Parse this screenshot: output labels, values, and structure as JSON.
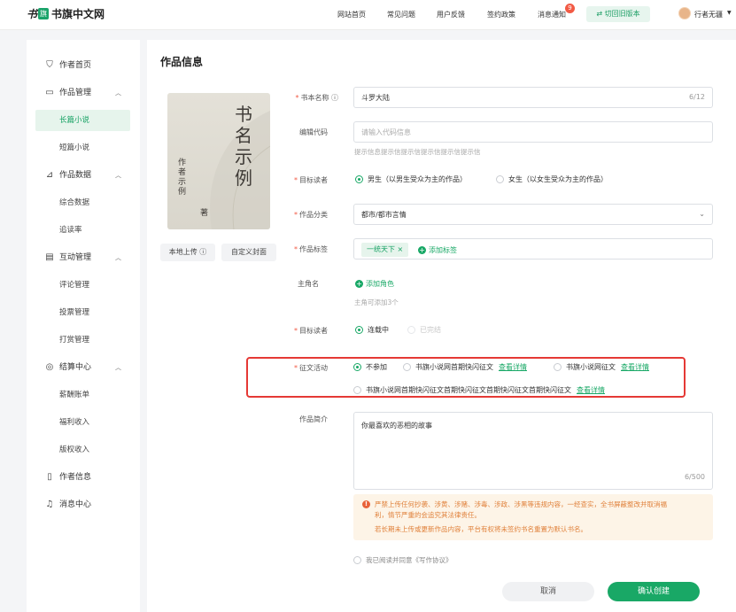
{
  "header": {
    "logo_mark": "书",
    "logo_box": "旗",
    "logo_text": "书旗中文网",
    "nav": [
      "网站首页",
      "常见问题",
      "用户反馈",
      "签约政策",
      "消息通知"
    ],
    "notification_count": "9",
    "switch_label": "⇄ 切回旧版本",
    "username": "行者无疆",
    "caret": "▼"
  },
  "sidebar": {
    "home": "作者首页",
    "works_manage": "作品管理",
    "long_novel": "长篇小说",
    "short_novel": "短篇小说",
    "works_data": "作品数据",
    "overall_data": "综合数据",
    "follow_rate": "追读率",
    "interaction": "互动管理",
    "comment_manage": "评论管理",
    "vote_manage": "投票管理",
    "reward_manage": "打赏管理",
    "settlement": "结算中心",
    "salary_bill": "薪酬账单",
    "welfare_income": "福利收入",
    "copyright_income": "版权收入",
    "author_info": "作者信息",
    "message_center": "消息中心"
  },
  "main": {
    "title": "作品信息",
    "cover": {
      "title_chars": "书名示例",
      "author_chars": "作者示例",
      "zhu": "著",
      "upload_label": "本地上传 ⓘ",
      "custom_label": "自定义封面"
    },
    "form": {
      "book_name": {
        "label": "书本名称 ⓘ",
        "value": "斗罗大陆",
        "count": "6/12"
      },
      "edit_code": {
        "label": "编辑代码",
        "placeholder": "请输入代码信息",
        "hint": "提示信息提示信提示信提示信提示信提示信"
      },
      "target_reader": {
        "label": "目标读者",
        "opt1": "男生（以男生受众为主的作品）",
        "opt2": "女生（以女生受众为主的作品）"
      },
      "category": {
        "label": "作品分类",
        "value": "都市/都市言情"
      },
      "tags": {
        "label": "作品标签",
        "tag1": "一统天下  ×",
        "add": "添加标签"
      },
      "protagonist": {
        "label": "主角名",
        "add": "添加角色",
        "hint": "主角可添加3个"
      },
      "status": {
        "label": "目标读者",
        "opt1": "连载中",
        "opt2": "已完结"
      },
      "contest": {
        "label": "征文活动",
        "opt1": "不参加",
        "opt2": "书旗小说网首期快闪征文",
        "opt3": "书旗小说网征文",
        "opt4": "书旗小说网首期快闪征文首期快闪征文首期快闪征文首期快闪征文",
        "detail": "查看详情"
      },
      "intro": {
        "label": "作品简介",
        "value": "你最喜欢的恶相的故事",
        "count": "6/500"
      },
      "warning": {
        "line1": "严禁上传任何抄袭、涉黄、涉赌、涉毒、涉政、涉黑等违规内容，一经查实，全书屏蔽整改并取消福",
        "line2": "利，情节严重的会追究其法律责任。",
        "line3": "若长期未上传或更新作品内容，平台有权将未签约书名重置为默认书名。"
      },
      "agreement": "我已阅读并同意《写作协议》"
    },
    "cancel": "取消",
    "confirm": "确认创建"
  }
}
